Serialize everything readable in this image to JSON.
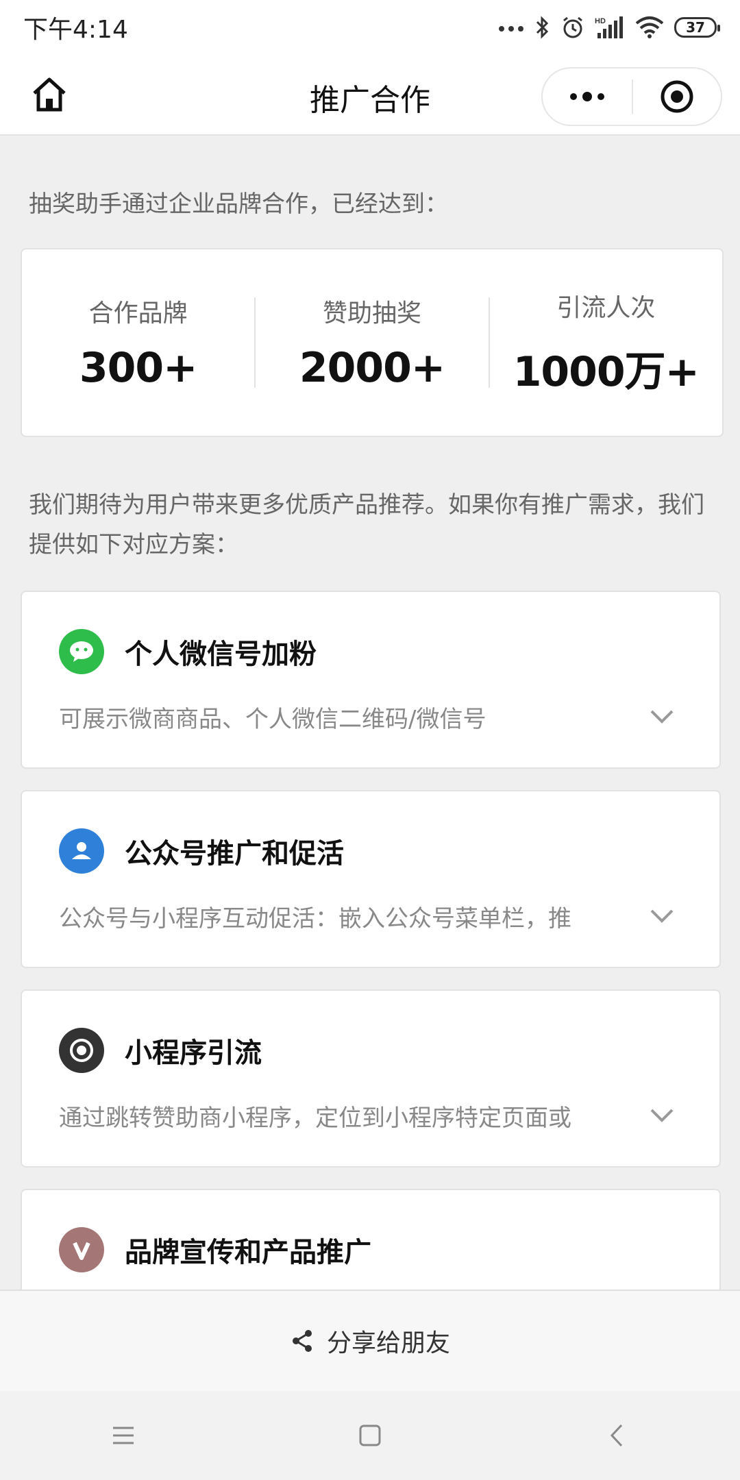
{
  "status_bar": {
    "time": "下午4:14",
    "battery": "37"
  },
  "navbar": {
    "title": "推广合作",
    "home_icon": "home-icon",
    "more_icon": "more-icon",
    "close_icon": "close-miniprogram-icon"
  },
  "intro_text": "抽奖助手通过企业品牌合作，已经达到：",
  "stats": [
    {
      "label": "合作品牌",
      "value": "300+"
    },
    {
      "label": "赞助抽奖",
      "value": "2000+"
    },
    {
      "label": "引流人次",
      "value": "1000万+"
    }
  ],
  "description": "我们期待为用户带来更多优质产品推荐。如果你有推广需求，我们提供如下对应方案：",
  "plans": [
    {
      "title": "个人微信号加粉",
      "subtitle": "可展示微商商品、个人微信二维码/微信号",
      "icon": "wechat-icon",
      "color": "#2ebd4a"
    },
    {
      "title": "公众号推广和促活",
      "subtitle": "公众号与小程序互动促活：嵌入公众号菜单栏，推",
      "icon": "official-account-icon",
      "color": "#2f80d8"
    },
    {
      "title": "小程序引流",
      "subtitle": "通过跳转赞助商小程序，定位到小程序特定页面或",
      "icon": "miniprogram-icon",
      "color": "#333333"
    },
    {
      "title": "品牌宣传和产品推广",
      "subtitle": "",
      "icon": "brand-v-icon",
      "color": "#a47676"
    }
  ],
  "share": {
    "label": "分享给朋友",
    "icon": "share-icon"
  },
  "system_nav": {
    "menu_icon": "menu-icon",
    "home_icon": "square-home-icon",
    "back_icon": "back-icon"
  }
}
